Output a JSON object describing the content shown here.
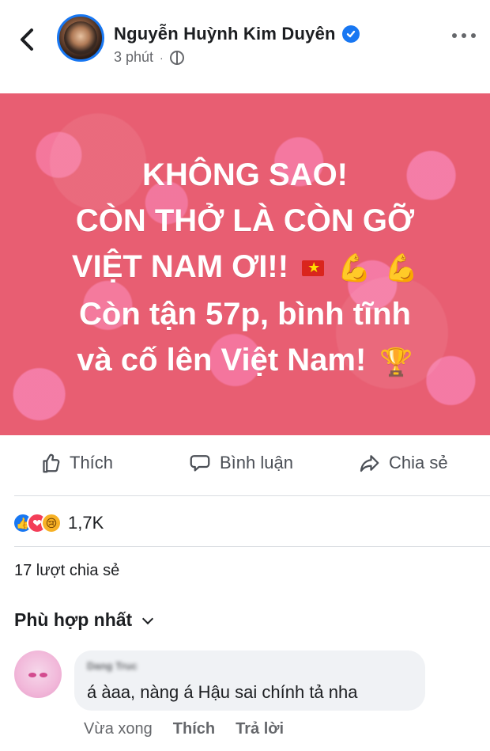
{
  "header": {
    "author_name": "Nguyễn Huỳnh Kim Duyên",
    "time": "3 phút",
    "separator": "·",
    "icons": {
      "back": "chevron-left-icon",
      "verified": "verified-check-icon",
      "privacy": "globe-icon",
      "more": "more-horizontal-icon"
    }
  },
  "post": {
    "text_lines": [
      "KHÔNG SAO!",
      "CÒN THỞ LÀ CÒN GỠ",
      "VIỆT NAM ƠI!!",
      "Còn tận 57p, bình tĩnh",
      "và cố lên Việt Nam!"
    ],
    "emojis": {
      "muscle": "💪",
      "trophy": "🏆"
    },
    "colors": {
      "background": "#e85e72",
      "heart_pink": "#ff96c8",
      "text": "#ffffff"
    }
  },
  "actions": {
    "like": "Thích",
    "comment": "Bình luận",
    "share": "Chia sẻ"
  },
  "reactions": {
    "count": "1,7K",
    "types": [
      "like",
      "love",
      "sad"
    ]
  },
  "shares": {
    "text": "17 lượt chia sẻ"
  },
  "comments": {
    "filter_label": "Phù hợp nhất",
    "items": [
      {
        "author": "Dang Truc",
        "text": "á àaa, nàng á Hậu sai chính tả nha",
        "time": "Vừa xong",
        "like": "Thích",
        "reply": "Trả lời"
      }
    ]
  }
}
